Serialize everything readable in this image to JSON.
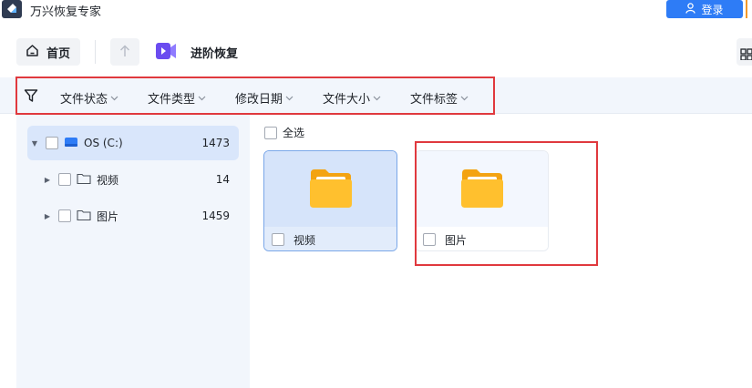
{
  "app": {
    "title": "万兴恢复专家",
    "login_label": "登录"
  },
  "nav": {
    "home_label": "首页",
    "section_title": "进阶恢复"
  },
  "filters": [
    "文件状态",
    "文件类型",
    "修改日期",
    "文件大小",
    "文件标签"
  ],
  "tree": [
    {
      "label": "OS (C:)",
      "count": "1473"
    },
    {
      "label": "视频",
      "count": "14"
    },
    {
      "label": "图片",
      "count": "1459"
    }
  ],
  "content": {
    "select_all_label": "全选",
    "folders": [
      {
        "name": "视频"
      },
      {
        "name": "图片"
      }
    ]
  },
  "colors": {
    "accent": "#2e7cf6",
    "highlight_box": "#e0393e",
    "folder": "#ffb31a"
  }
}
